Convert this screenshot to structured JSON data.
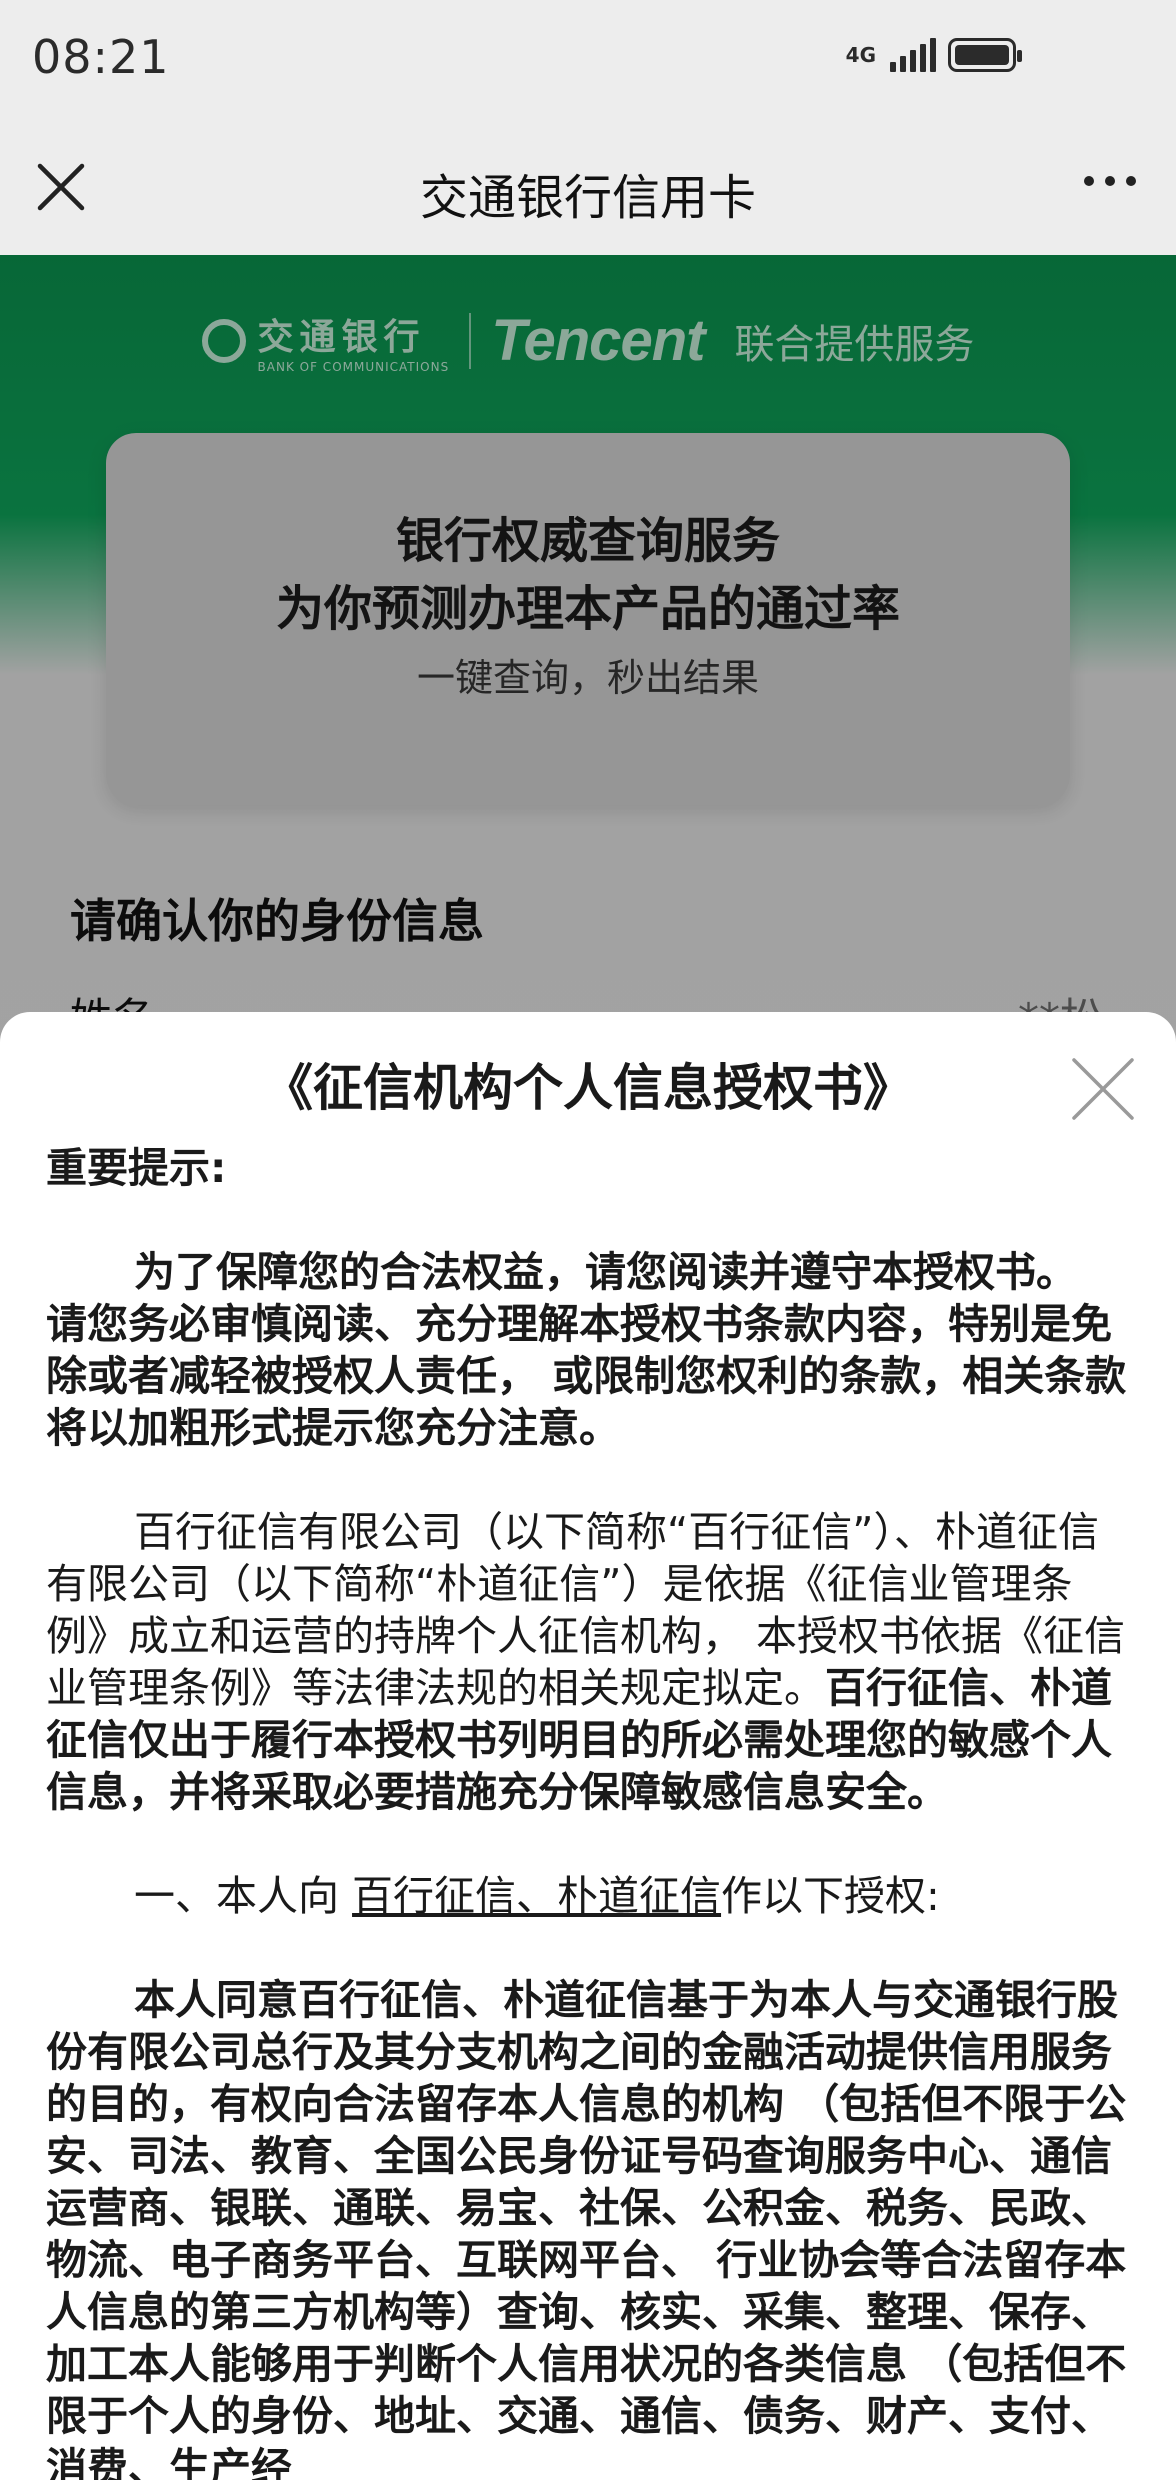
{
  "status_bar": {
    "time": "08:21",
    "network": "4G",
    "signal_icon": "signal-bars-icon",
    "battery_icon": "battery-icon"
  },
  "nav": {
    "title": "交通银行信用卡",
    "close_icon": "close-icon",
    "more_icon": "more-dots-icon"
  },
  "brand": {
    "bank_cn": "交通银行",
    "bank_en": "BANK OF COMMUNICATIONS",
    "partner": "Tencent",
    "joint_text": "联合提供服务"
  },
  "hero": {
    "line1": "银行权威查询服务",
    "line2": "为你预测办理本产品的通过率",
    "line3": "一键查询，秒出结果"
  },
  "identity": {
    "title": "请确认你的身份信息",
    "name_label": "姓名",
    "name_value": "**松"
  },
  "sheet": {
    "title": "《征信机构个人信息授权书》",
    "important_label": "重要提示:",
    "para1": "为了保障您的合法权益，请您阅读并遵守本授权书。 请您务必审慎阅读、充分理解本授权书条款内容，特别是免除或者减轻被授权人责任， 或限制您权利的条款，相关条款将以加粗形式提示您充分注意。",
    "para2_normal": "百行征信有限公司（以下简称“百行征信”）、朴道征信有限公司（以下简称“朴道征信”）是依据《征信业管理条例》成立和运营的持牌个人征信机构， 本授权书依据《征信业管理条例》等法律法规的相关规定拟定。",
    "para2_bold": "百行征信、朴道征信仅出于履行本授权书列明目的所必需处理您的敏感个人信息，并将采取必要措施充分保障敏感信息安全。",
    "para3_prefix": "一、本人向 ",
    "para3_link": "百行征信、朴道征信",
    "para3_suffix": "作以下授权:",
    "para4": "本人同意百行征信、朴道征信基于为本人与交通银行股份有限公司总行及其分支机构之间的金融活动提供信用服务的目的，有权向合法留存本人信息的机构 （包括但不限于公安、司法、教育、全国公民身份证号码查询服务中心、通信运营商、银联、通联、易宝、社保、公积金、税务、民政、物流、电子商务平台、互联网平台、 行业协会等合法留存本人信息的第三方机构等）查询、核实、采集、整理、保存、加工本人能够用于判断个人信用状况的各类信息 （包括但不限于个人的身份、地址、交通、通信、债务、财产、支付、消费、生产经"
  }
}
